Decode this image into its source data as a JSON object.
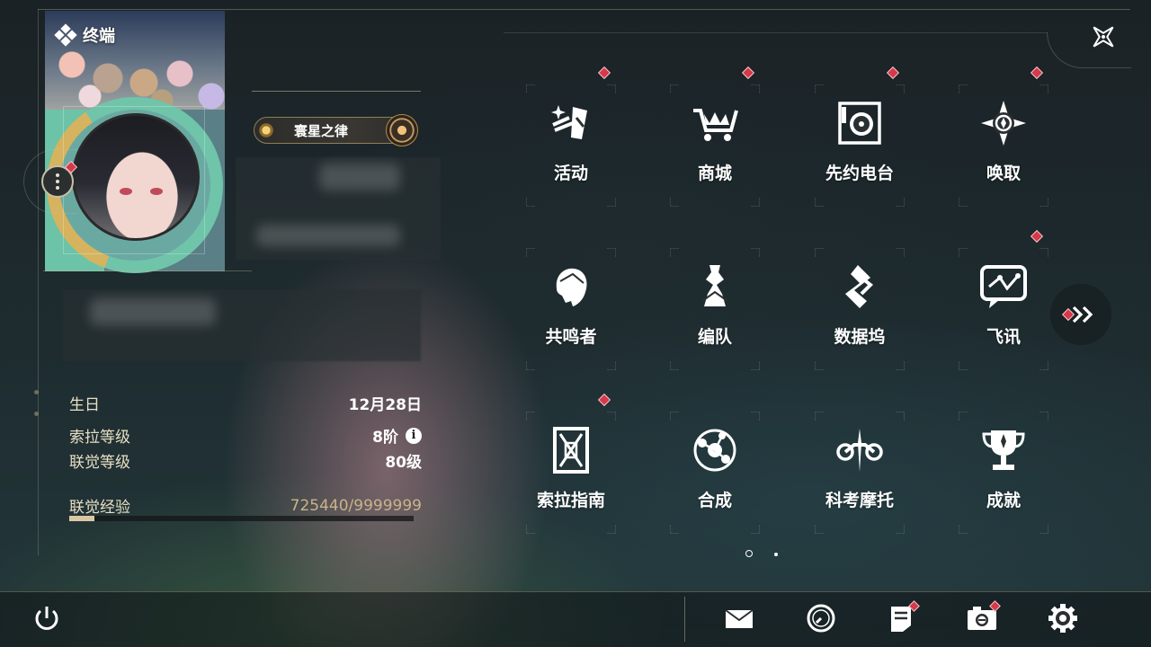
{
  "header": {
    "title": "终端",
    "close_label": "close"
  },
  "profile": {
    "name_plate": "寰星之律",
    "birthday_label": "生日",
    "birthday_value": "12月28日",
    "sola_level_label": "索拉等级",
    "sola_level_value": "8阶",
    "union_level_label": "联觉等级",
    "union_level_value": "80级",
    "union_exp_label": "联觉经验",
    "union_exp_value": "725440/9999999",
    "union_exp_progress": 0.0726
  },
  "menu": {
    "items": [
      {
        "label": "活动",
        "icon": "events-icon",
        "badge": true
      },
      {
        "label": "商城",
        "icon": "shop-cart-icon",
        "badge": true
      },
      {
        "label": "先约电台",
        "icon": "radio-icon",
        "badge": true
      },
      {
        "label": "唤取",
        "icon": "convene-compass-icon",
        "badge": true
      },
      {
        "label": "共鸣者",
        "icon": "resonator-head-icon",
        "badge": false
      },
      {
        "label": "编队",
        "icon": "team-chess-icon",
        "badge": false
      },
      {
        "label": "数据坞",
        "icon": "data-bank-icon",
        "badge": false
      },
      {
        "label": "飞讯",
        "icon": "message-bubble-icon",
        "badge": true
      },
      {
        "label": "索拉指南",
        "icon": "guidebook-icon",
        "badge": true
      },
      {
        "label": "合成",
        "icon": "synthesis-icon",
        "badge": false
      },
      {
        "label": "科考摩托",
        "icon": "motorbike-icon",
        "badge": false
      },
      {
        "label": "成就",
        "icon": "trophy-icon",
        "badge": false
      }
    ],
    "current_page": 1,
    "page_count": 2
  },
  "bottom_bar": {
    "buttons": [
      {
        "name": "power",
        "icon": "power-icon",
        "badge": false
      },
      {
        "name": "mail",
        "icon": "mail-icon",
        "badge": false
      },
      {
        "name": "time",
        "icon": "clock-icon",
        "badge": false
      },
      {
        "name": "notice",
        "icon": "notice-icon",
        "badge": true
      },
      {
        "name": "photo",
        "icon": "camera-icon",
        "badge": true
      },
      {
        "name": "settings",
        "icon": "gear-icon",
        "badge": false
      }
    ]
  },
  "colors": {
    "accent_gold": "#c9b38a",
    "badge_red": "#d5394a",
    "text_white": "#ffffff"
  }
}
